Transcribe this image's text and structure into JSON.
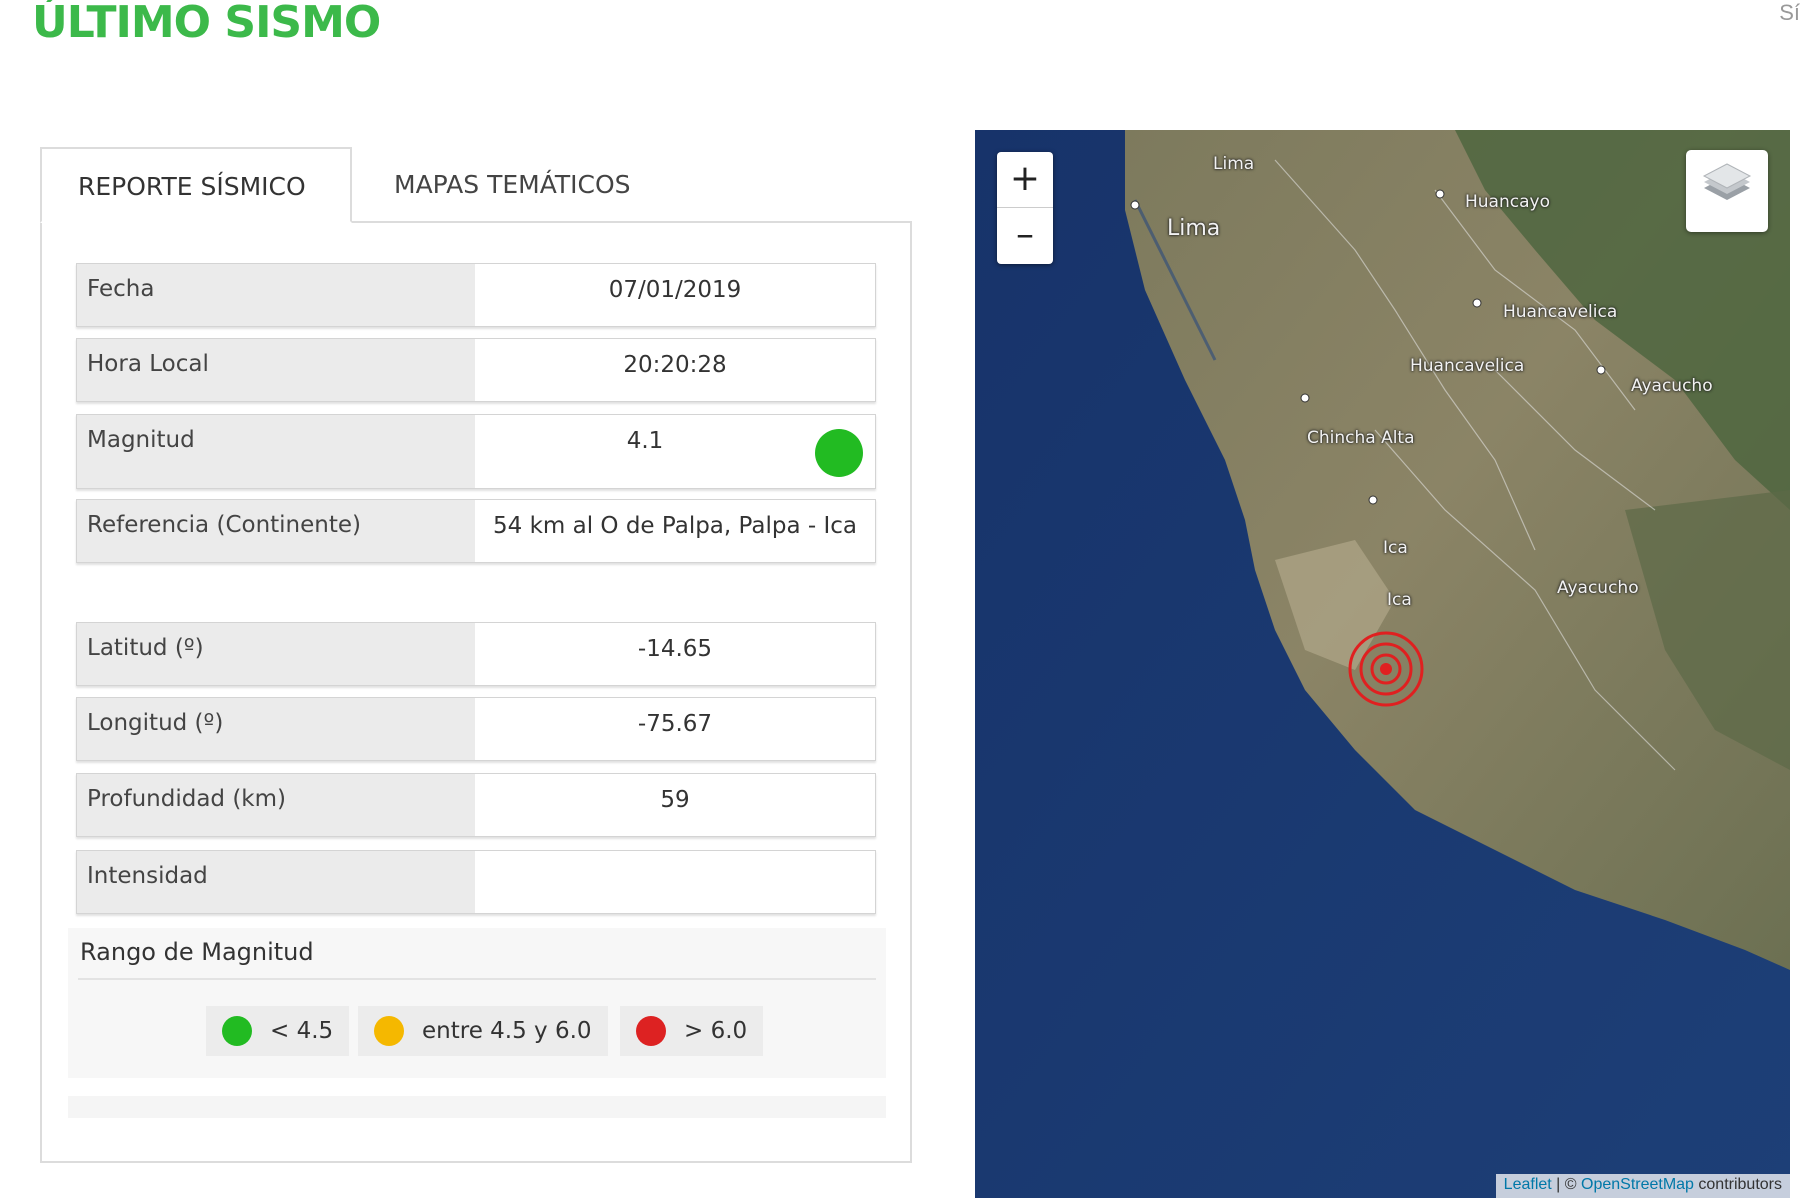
{
  "header": {
    "title": "ÚLTIMO SISMO",
    "corner_text": "Sí"
  },
  "tabs": [
    {
      "label": "REPORTE SÍSMICO",
      "active": true
    },
    {
      "label": "MAPAS TEMÁTICOS",
      "active": false
    }
  ],
  "report": {
    "fecha": {
      "label": "Fecha",
      "value": "07/01/2019"
    },
    "hora": {
      "label": "Hora Local",
      "value": "20:20:28"
    },
    "magnitud": {
      "label": "Magnitud",
      "value": "4.1",
      "indicator_color": "#22bb22"
    },
    "referencia": {
      "label": "Referencia (Continente)",
      "value": "54 km al O de Palpa, Palpa - Ica"
    },
    "latitud": {
      "label": "Latitud (º)",
      "value": "-14.65"
    },
    "longitud": {
      "label": "Longitud (º)",
      "value": "-75.67"
    },
    "profundidad": {
      "label": "Profundidad (km)",
      "value": "59"
    },
    "intensidad": {
      "label": "Intensidad",
      "value": ""
    }
  },
  "range": {
    "title": "Rango de Magnitud",
    "items": [
      {
        "label": "< 4.5",
        "color": "#22bb22"
      },
      {
        "label": "entre 4.5 y 6.0",
        "color": "#f5b800"
      },
      {
        "label": "> 6.0",
        "color": "#dd2222"
      }
    ]
  },
  "map": {
    "zoom_in": "+",
    "zoom_out": "–",
    "cities": [
      "Lima",
      "Lima",
      "Huancayo",
      "Huancavelica",
      "Huancavelica",
      "Ayacucho",
      "Chincha Alta",
      "Ica",
      "Ica",
      "Ayacucho"
    ],
    "attribution": {
      "leaflet": "Leaflet",
      "sep": " | © ",
      "osm": "OpenStreetMap",
      "suffix": " contributors"
    },
    "epicenter_color": "#e02020"
  }
}
